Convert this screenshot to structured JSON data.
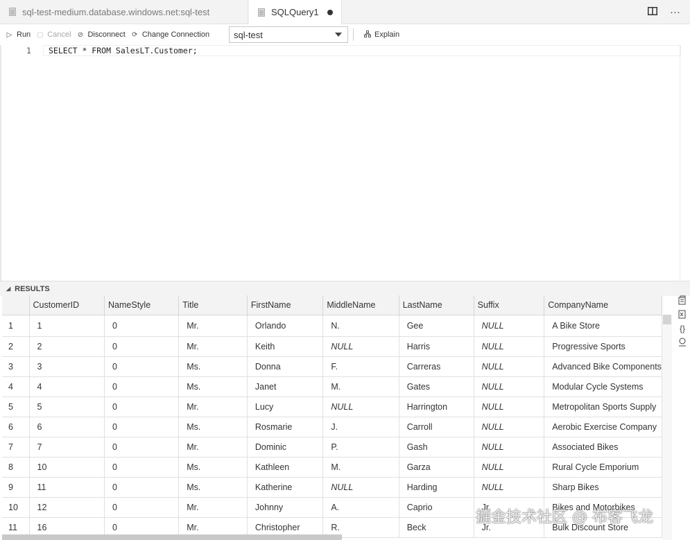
{
  "tabs": [
    {
      "label": "sql-test-medium.database.windows.net:sql-test"
    },
    {
      "label": "SQLQuery1"
    }
  ],
  "toolbar": {
    "run_label": "Run",
    "cancel_label": "Cancel",
    "disconnect_label": "Disconnect",
    "change_connection_label": "Change Connection",
    "database_selected": "sql-test",
    "explain_label": "Explain"
  },
  "editor": {
    "line_number": "1",
    "code": "SELECT * FROM SalesLT.Customer;"
  },
  "results": {
    "header_label": "RESULTS",
    "columns": [
      "",
      "CustomerID",
      "NameStyle",
      "Title",
      "FirstName",
      "MiddleName",
      "LastName",
      "Suffix",
      "CompanyName"
    ],
    "rows": [
      [
        "1",
        "1",
        "0",
        "Mr.",
        "Orlando",
        "N.",
        "Gee",
        "NULL",
        "A Bike Store"
      ],
      [
        "2",
        "2",
        "0",
        "Mr.",
        "Keith",
        "NULL",
        "Harris",
        "NULL",
        "Progressive Sports"
      ],
      [
        "3",
        "3",
        "0",
        "Ms.",
        "Donna",
        "F.",
        "Carreras",
        "NULL",
        "Advanced Bike Components"
      ],
      [
        "4",
        "4",
        "0",
        "Ms.",
        "Janet",
        "M.",
        "Gates",
        "NULL",
        "Modular Cycle Systems"
      ],
      [
        "5",
        "5",
        "0",
        "Mr.",
        "Lucy",
        "NULL",
        "Harrington",
        "NULL",
        "Metropolitan Sports Supply"
      ],
      [
        "6",
        "6",
        "0",
        "Ms.",
        "Rosmarie",
        "J.",
        "Carroll",
        "NULL",
        "Aerobic Exercise Company"
      ],
      [
        "7",
        "7",
        "0",
        "Mr.",
        "Dominic",
        "P.",
        "Gash",
        "NULL",
        "Associated Bikes"
      ],
      [
        "8",
        "10",
        "0",
        "Ms.",
        "Kathleen",
        "M.",
        "Garza",
        "NULL",
        "Rural Cycle Emporium"
      ],
      [
        "9",
        "11",
        "0",
        "Ms.",
        "Katherine",
        "NULL",
        "Harding",
        "NULL",
        "Sharp Bikes"
      ],
      [
        "10",
        "12",
        "0",
        "Mr.",
        "Johnny",
        "A.",
        "Caprio",
        "Jr.",
        "Bikes and Motorbikes"
      ],
      [
        "11",
        "16",
        "0",
        "Mr.",
        "Christopher",
        "R.",
        "Beck",
        "Jr.",
        "Bulk Discount Store"
      ]
    ]
  },
  "icons": {
    "file": "file-icon",
    "split": "split-editor-icon",
    "more": "more-icon",
    "side": [
      "export-csv-icon",
      "export-excel-icon",
      "export-json-icon",
      "chart-icon"
    ]
  },
  "watermark": "掘金技术社区 @ 布客飞龙"
}
